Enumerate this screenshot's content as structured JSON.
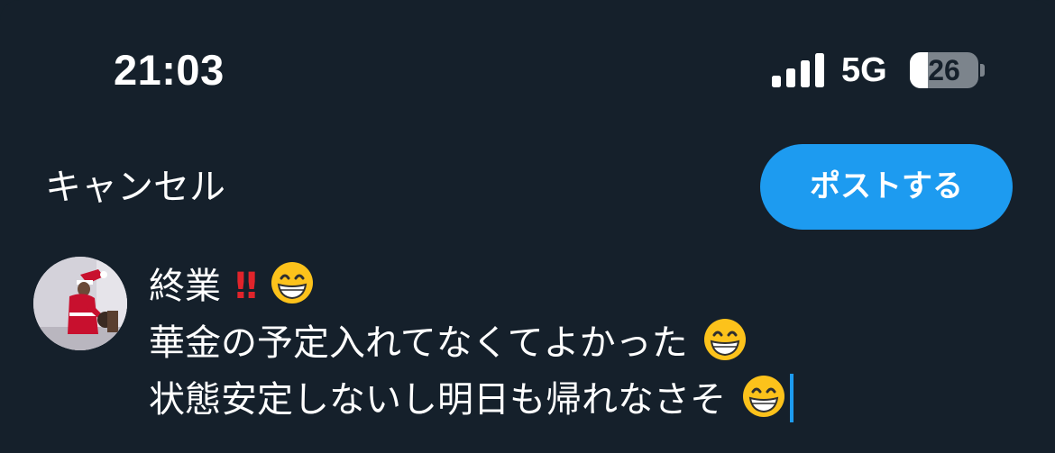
{
  "status_bar": {
    "time": "21:03",
    "network": "5G",
    "battery_level": "26",
    "battery_fraction": 0.26
  },
  "composer": {
    "cancel_label": "キャンセル",
    "post_label": "ポストする"
  },
  "tweet": {
    "line1": "終業",
    "line1_marks": "!!",
    "line2": "華金の予定入れてなくてよかった",
    "line3": "状態安定しないし明日も帰れなさそ"
  },
  "colors": {
    "background": "#15202b",
    "accent": "#1d9bf0",
    "text": "#ffffff",
    "exclamation": "#e0242b"
  },
  "icons": {
    "signal": "cellular-signal-icon",
    "battery": "battery-icon",
    "emoji": "grinning-face-emoji"
  }
}
